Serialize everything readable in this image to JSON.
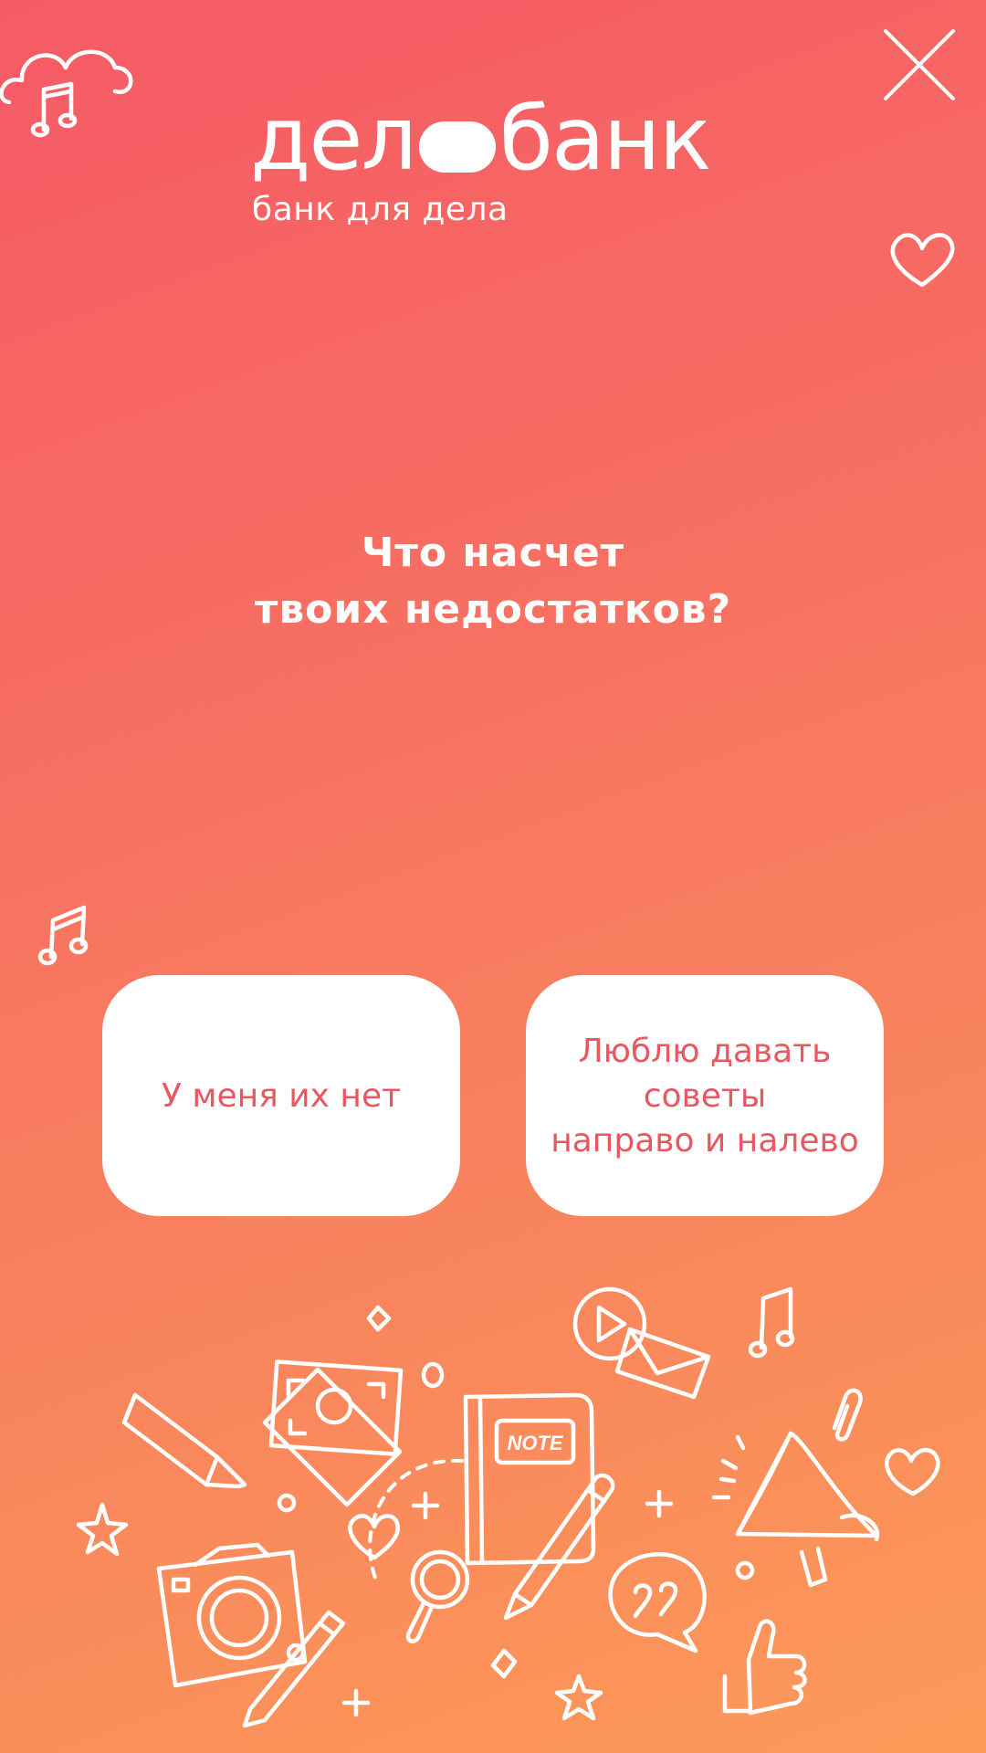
{
  "brand": {
    "name_part1": "дел",
    "name_part2": "банк",
    "tagline": "банк для дела"
  },
  "question": {
    "line1": "Что насчет",
    "line2": "твоих недостатков?"
  },
  "answers": [
    {
      "label": "У меня их нет"
    },
    {
      "line1": "Люблю давать",
      "line2": "советы",
      "line3": "направо и налево"
    }
  ],
  "icons": {
    "close": "close-icon",
    "decor": [
      "cloud-music-icon",
      "heart-icon",
      "music-note-icon",
      "doodles-illustration"
    ]
  },
  "colors": {
    "background_top": "#f65a66",
    "background_bottom": "#fd9a59",
    "answer_text": "#e85860",
    "card": "#ffffff"
  }
}
